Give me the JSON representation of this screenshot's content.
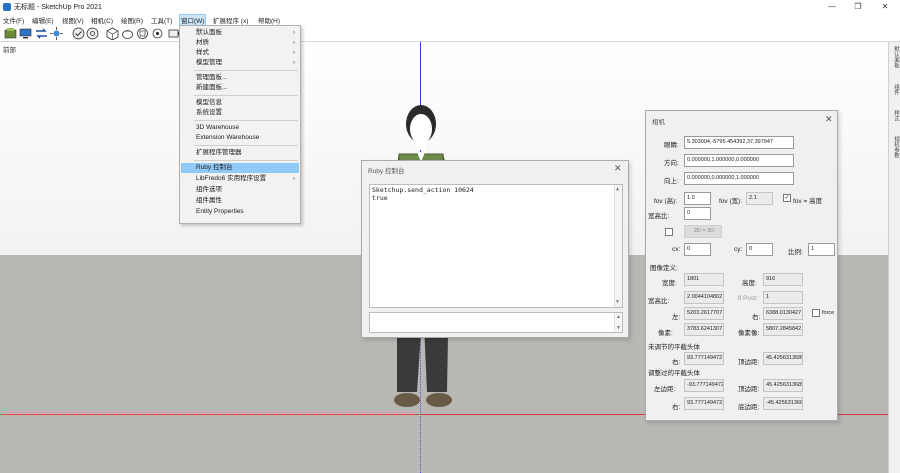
{
  "window": {
    "title": "无标题 - SketchUp Pro 2021",
    "minimize": "—",
    "maximize": "❐",
    "close": "✕"
  },
  "menubar": [
    {
      "label": "文件(F)"
    },
    {
      "label": "编辑(E)"
    },
    {
      "label": "视图(V)"
    },
    {
      "label": "相机(C)"
    },
    {
      "label": "绘图(R)"
    },
    {
      "label": "工具(T)"
    },
    {
      "label": "窗口(W)"
    },
    {
      "label": "扩展程序 (x)"
    },
    {
      "label": "帮助(H)"
    }
  ],
  "toolbar": {
    "icons": [
      "file-icon",
      "monitor-icon",
      "swap-icon",
      "sparkle-icon",
      "check-circle-icon",
      "globe-icon",
      "cube-icon",
      "teapot-icon",
      "refresh-cube-icon",
      "settings-icon",
      "camera-icon"
    ]
  },
  "viewport": {
    "scene_label": "前部"
  },
  "tray_tabs": [
    "默认面板",
    "组件",
    "样式",
    "相机参数"
  ],
  "window_menu": {
    "items": [
      {
        "label": "默认面板",
        "submenu": true
      },
      {
        "label": "材质",
        "submenu": true
      },
      {
        "label": "样式",
        "submenu": true
      },
      {
        "label": "模型管理",
        "submenu": true
      },
      {
        "sep": true
      },
      {
        "label": "管理面板..."
      },
      {
        "label": "新建面板..."
      },
      {
        "sep": true
      },
      {
        "label": "模型信息"
      },
      {
        "label": "系统设置"
      },
      {
        "sep": true
      },
      {
        "label": "3D Warehouse"
      },
      {
        "label": "Extension Warehouse"
      },
      {
        "sep": true
      },
      {
        "label": "扩展程序管理器"
      },
      {
        "sep": true
      },
      {
        "label": "Ruby 控制台",
        "highlight": true
      },
      {
        "label": "LibFredo6 实用程序设置",
        "submenu": true
      },
      {
        "label": "组件选项"
      },
      {
        "label": "组件属性"
      },
      {
        "label": "Entity Properties"
      }
    ]
  },
  "ruby_console": {
    "title": "Ruby 控制台",
    "close": "✕",
    "output": "Sketchup.send_action 10624\ntrue",
    "input_value": ""
  },
  "camera_dialog": {
    "title": "相机",
    "close": "✕",
    "eye_label": "眼睛:",
    "eye_value": "5.303004,-5795.454392,37.397947",
    "dir_label": "方向:",
    "dir_value": "0.000000,1.000000,0.000000",
    "up_label": "向上:",
    "up_value": "0.000000,0.000000,1.000000",
    "fovh_label": "fov (高):",
    "fovh_value": "1.0",
    "fovw_label": "fov (宽):",
    "fovw_value": "2.1",
    "fov_is_height_label": "fov = 高度",
    "fov_is_height_checked": "✓",
    "aspect_label": "宽高比:",
    "aspect_value": "0",
    "twod_value": "2D = 3D",
    "cx_label": "cx:",
    "cx_value": "0",
    "cy_label": "cy:",
    "cy_value": "0",
    "scale_label": "比例:",
    "scale_value": "1",
    "image_section": "图像定义:",
    "width_label": "宽度:",
    "width_value": "1801",
    "height_label": "高度:",
    "height_value": "916",
    "ratio_label": "宽高比:",
    "ratio_value": "2.0044104802",
    "field_label": "fl Post:",
    "field_value": "1",
    "left_label": "左:",
    "left_value": "5203.2617707",
    "right_label": "右:",
    "right_value": "6388.0130427",
    "force_label": "force",
    "px_label": "像素:",
    "px_value": "3783.6241307",
    "py_label": "像素像:",
    "py_value": "5807.2845842",
    "unadj_section": "未调节的平截头体",
    "unadj_right_label": "右:",
    "unadj_right_value": "93.7771494721",
    "unadj_top_label": "顶边距:",
    "unadj_top_value": "45.4256313689",
    "adj_section": "调整过的平截头体",
    "adj_left_label": "左边距:",
    "adj_left_value": "-93.7771494721",
    "adj_top_label": "顶边距:",
    "adj_top_value": "45.4256313689",
    "adj_right_label": "右:",
    "adj_right_value": "93.7771494721",
    "adj_bottom_label": "底边距:",
    "adj_bottom_value": "-45.4256313689"
  }
}
